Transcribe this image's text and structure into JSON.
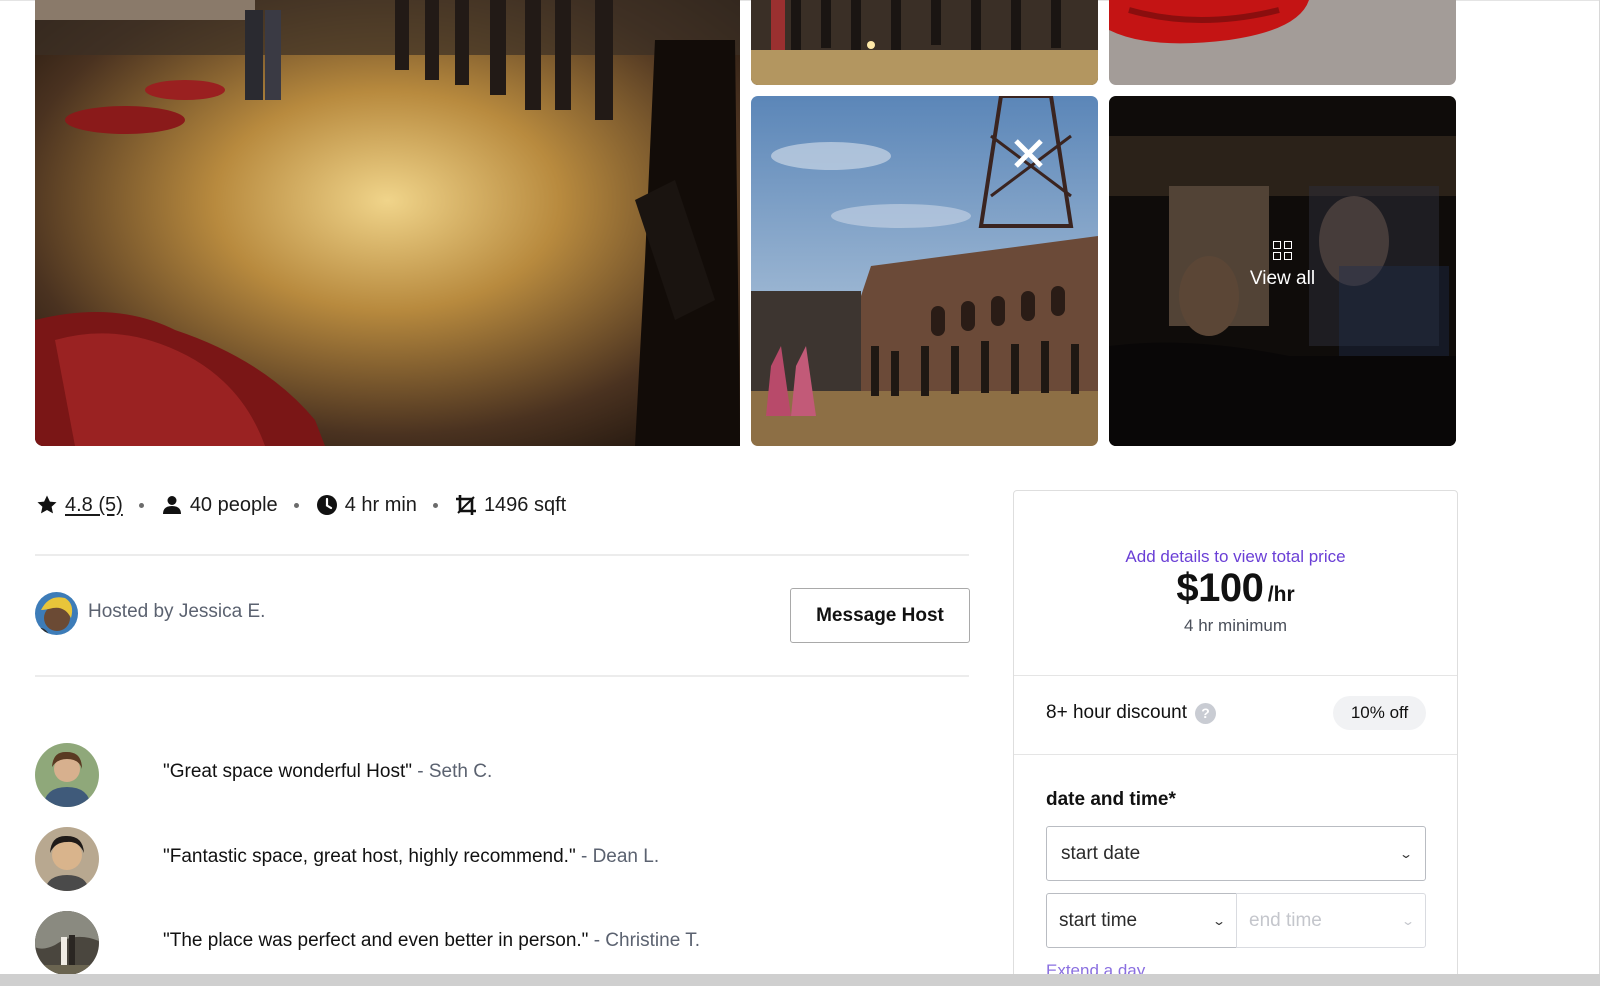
{
  "gallery": {
    "view_all_label": "View all"
  },
  "stats": {
    "rating": "4.8 (5)",
    "capacity": "40 people",
    "minimum": "4 hr min",
    "area": "1496 sqft"
  },
  "host": {
    "hosted_by": "Hosted by Jessica E.",
    "message_button": "Message Host"
  },
  "reviews": [
    {
      "quote": "\"Great space wonderful Host\"",
      "author": "- Seth C."
    },
    {
      "quote": "\"Fantastic space, great host, highly recommend.\"",
      "author": "- Dean L."
    },
    {
      "quote": "\"The place was perfect and even better in person.\"",
      "author": "- Christine T."
    }
  ],
  "booking": {
    "add_details_link": "Add details to view total price",
    "price": "$100",
    "price_unit": "/hr",
    "minimum_note": "4 hr minimum",
    "discount_label": "8+ hour discount",
    "help_icon": "?",
    "discount_value": "10% off",
    "date_time_label": "date and time*",
    "start_date_placeholder": "start date",
    "start_time_placeholder": "start time",
    "end_time_placeholder": "end time",
    "extend_link": "Extend a day"
  },
  "colors": {
    "accent": "#6a3fd6",
    "muted_text": "#5b6270",
    "border": "#dedede"
  }
}
